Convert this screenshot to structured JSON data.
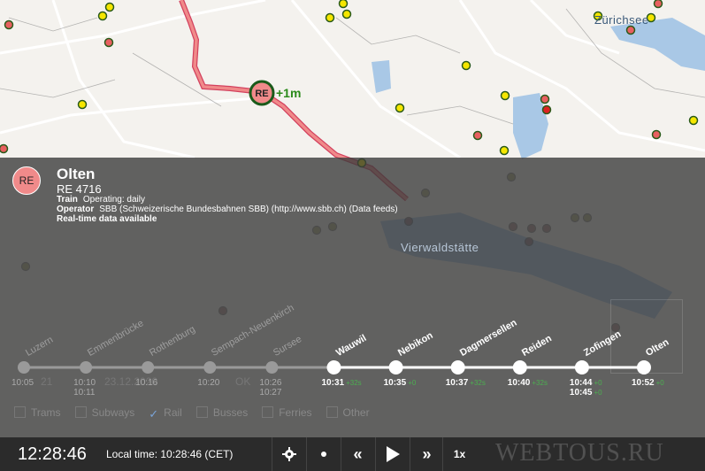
{
  "map": {
    "labels": [
      "Zürichsee",
      "Vierwaldstätte"
    ],
    "train_marker": "RE",
    "train_delay": "+1m"
  },
  "info": {
    "badge": "RE",
    "title": "Olten",
    "train_number": "RE 4716",
    "train_label": "Train",
    "train_value": "Operating: daily",
    "operator_label": "Operator",
    "operator_value": "SBB (Schweizerische Bundesbahnen SBB) (http://www.sbb.ch) (Data feeds)",
    "realtime": "Real-time data available"
  },
  "stops": [
    {
      "name": "Luzern",
      "times": [
        "10:05"
      ],
      "delays": [
        ""
      ],
      "past": true
    },
    {
      "name": "Emmenbrücke",
      "times": [
        "10:10",
        "10:11"
      ],
      "delays": [
        "",
        ""
      ],
      "past": true
    },
    {
      "name": "Rothenburg",
      "times": [
        "10:16"
      ],
      "delays": [
        ""
      ],
      "past": true
    },
    {
      "name": "Sempach-Neuenkirch",
      "times": [
        "10:20"
      ],
      "delays": [
        ""
      ],
      "past": true
    },
    {
      "name": "Sursee",
      "times": [
        "10:26",
        "10:27"
      ],
      "delays": [
        "",
        ""
      ],
      "past": true
    },
    {
      "name": "Wauwil",
      "times": [
        "10:31"
      ],
      "delays": [
        "+32s"
      ],
      "past": false
    },
    {
      "name": "Nebikon",
      "times": [
        "10:35"
      ],
      "delays": [
        "+0"
      ],
      "past": false
    },
    {
      "name": "Dagmersellen",
      "times": [
        "10:37"
      ],
      "delays": [
        "+32s"
      ],
      "past": false
    },
    {
      "name": "Reiden",
      "times": [
        "10:40"
      ],
      "delays": [
        "+32s"
      ],
      "past": false
    },
    {
      "name": "Zofingen",
      "times": [
        "10:44",
        "10:45"
      ],
      "delays": [
        "+0",
        "+0"
      ],
      "past": false
    },
    {
      "name": "Olten",
      "times": [
        "10:52"
      ],
      "delays": [
        "+0"
      ],
      "past": false
    }
  ],
  "hidden_controls": {
    "date": "23.12.2020",
    "time_fragment": "21",
    "ok": "OK"
  },
  "filters": [
    {
      "label": "Trams",
      "checked": false
    },
    {
      "label": "Subways",
      "checked": false
    },
    {
      "label": "Rail",
      "checked": true
    },
    {
      "label": "Busses",
      "checked": false
    },
    {
      "label": "Ferries",
      "checked": false
    },
    {
      "label": "Other",
      "checked": false
    }
  ],
  "bottombar": {
    "clock": "12:28:46",
    "local_time": "Local time: 10:28:46 (CET)",
    "speed": "1x"
  },
  "icons": {
    "settings": "gear-icon",
    "dot": "dot-icon",
    "rewind": "rewind-icon",
    "play": "play-icon",
    "forward": "fast-forward-icon"
  },
  "watermark": "WEBTOUS.RU",
  "colors": {
    "route": "#f08a8a",
    "delay": "#4caf50",
    "stop_yellow": "#f5e600",
    "stop_red": "#e86060",
    "lake": "#a9c8e6"
  }
}
